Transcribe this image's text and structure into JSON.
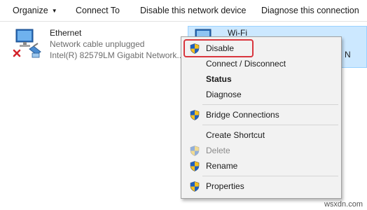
{
  "toolbar": {
    "organize": "Organize",
    "connect_to": "Connect To",
    "disable_device": "Disable this network device",
    "diagnose": "Diagnose this connection"
  },
  "ethernet": {
    "name": "Ethernet",
    "status": "Network cable unplugged",
    "device": "Intel(R) 82579LM Gigabit Network..."
  },
  "wifi": {
    "name": "Wi-Fi",
    "partial": "N"
  },
  "context_menu": {
    "items": [
      {
        "label": "Disable",
        "icon": "shield-icon"
      },
      {
        "label": "Connect / Disconnect"
      },
      {
        "label": "Status"
      },
      {
        "label": "Diagnose"
      },
      {
        "label": "Bridge Connections",
        "icon": "shield-icon"
      },
      {
        "label": "Create Shortcut"
      },
      {
        "label": "Delete",
        "icon": "shield-icon",
        "disabled": true
      },
      {
        "label": "Rename",
        "icon": "shield-icon"
      },
      {
        "label": "Properties",
        "icon": "shield-icon"
      }
    ]
  },
  "watermark": "wsxdn.com",
  "colors": {
    "selection": "#cce8ff",
    "highlight_border": "#d9363e",
    "shield_blue": "#1f5fbf",
    "shield_yellow": "#f4c01e"
  }
}
